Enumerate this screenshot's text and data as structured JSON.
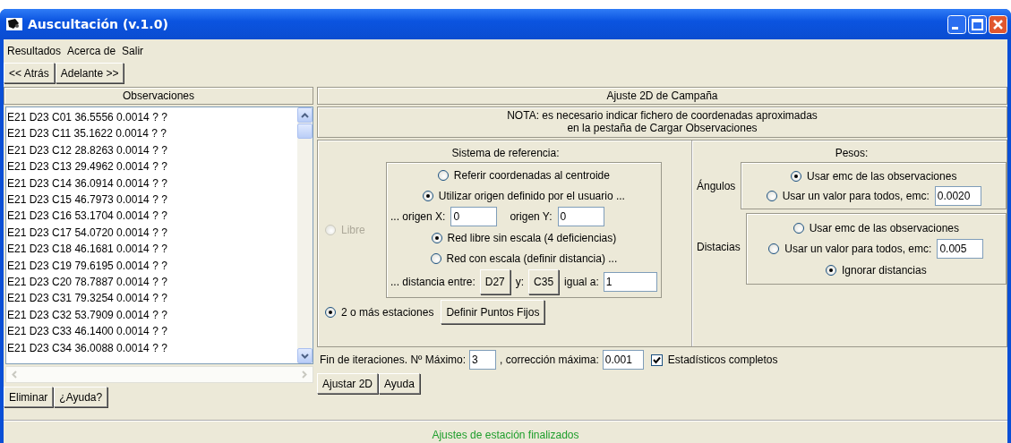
{
  "window": {
    "title": "Auscultación (v.1.0)"
  },
  "menu": [
    "Resultados",
    "Acerca de",
    "Salir"
  ],
  "nav_buttons": [
    "<< Atrás",
    "Adelante >>"
  ],
  "observations": {
    "title": "Observaciones",
    "rows": [
      "E21 D23 C01 36.5556 0.0014 ? ?",
      "E21 D23 C11 35.1622 0.0014 ? ?",
      "E21 D23 C12 28.8263 0.0014 ? ?",
      "E21 D23 C13 29.4962 0.0014 ? ?",
      "E21 D23 C14 36.0914 0.0014 ? ?",
      "E21 D23 C15 46.7973 0.0014 ? ?",
      "E21 D23 C16 53.1704 0.0014 ? ?",
      "E21 D23 C17 54.0720 0.0014 ? ?",
      "E21 D23 C18 46.1681 0.0014 ? ?",
      "E21 D23 C19 79.6195 0.0014 ? ?",
      "E21 D23 C20 78.7887 0.0014 ? ?",
      "E21 D23 C31 79.3254 0.0014 ? ?",
      "E21 D23 C32 53.7909 0.0014 ? ?",
      "E21 D23 C33 46.1400 0.0014 ? ?",
      "E21 D23 C34 36.0088 0.0014 ? ?"
    ],
    "buttons": [
      "Eliminar",
      "¿Ayuda?"
    ]
  },
  "adjustment": {
    "title": "Ajuste 2D de Campaña",
    "note": [
      "NOTA: es necesario indicar fichero de coordenadas aproximadas",
      "en la pestaña de Cargar Observaciones"
    ],
    "reference": {
      "title": "Sistema de referencia:",
      "libre": {
        "label": "Libre",
        "selected": false,
        "disabled": true
      },
      "centroid": {
        "label": "Referir coordenadas al centroide",
        "selected": false
      },
      "user_origin": {
        "label": "Utilizar origen definido por el usuario ...",
        "selected": true
      },
      "origin_x": {
        "label": "... origen X:",
        "value": "0"
      },
      "origin_y": {
        "label": "origen Y:",
        "value": "0"
      },
      "free_net": {
        "label": "Red libre sin escala (4 deficiencias)",
        "selected": true
      },
      "scaled_net": {
        "label": "Red con escala (definir distancia) ...",
        "selected": false
      },
      "distance": {
        "label": "... distancia entre:",
        "from": "D27",
        "and_label": "y:",
        "to": "C35",
        "equal_label": "igual a:",
        "value": "1"
      },
      "multi_station": {
        "label": "2 o más estaciones",
        "selected": true
      },
      "fixed_points_button": "Definir Puntos Fijos"
    },
    "weights": {
      "title": "Pesos:",
      "angles": {
        "label": "Ángulos",
        "use_obs": {
          "label": "Usar emc de las observaciones",
          "selected": true
        },
        "use_value": {
          "label": "Usar un valor para todos, emc:",
          "selected": false,
          "value": "0.0020"
        }
      },
      "distances": {
        "label": "Distacias",
        "use_obs": {
          "label": "Usar emc de las observaciones",
          "selected": false
        },
        "use_value": {
          "label": "Usar un valor para todos, emc:",
          "selected": false,
          "value": "0.005"
        },
        "ignore": {
          "label": "Ignorar distancias",
          "selected": true
        }
      }
    },
    "iterations": {
      "max_label": "Fin de iteraciones. Nº Máximo:",
      "max_value": "3",
      "corr_label": ", corrección máxima:",
      "corr_value": "0.001",
      "stats": {
        "label": "Estadísticos completos",
        "checked": true
      }
    },
    "buttons": [
      "Ajustar 2D",
      "Ayuda"
    ]
  },
  "status_bar": "Ajustes de estación finalizados"
}
